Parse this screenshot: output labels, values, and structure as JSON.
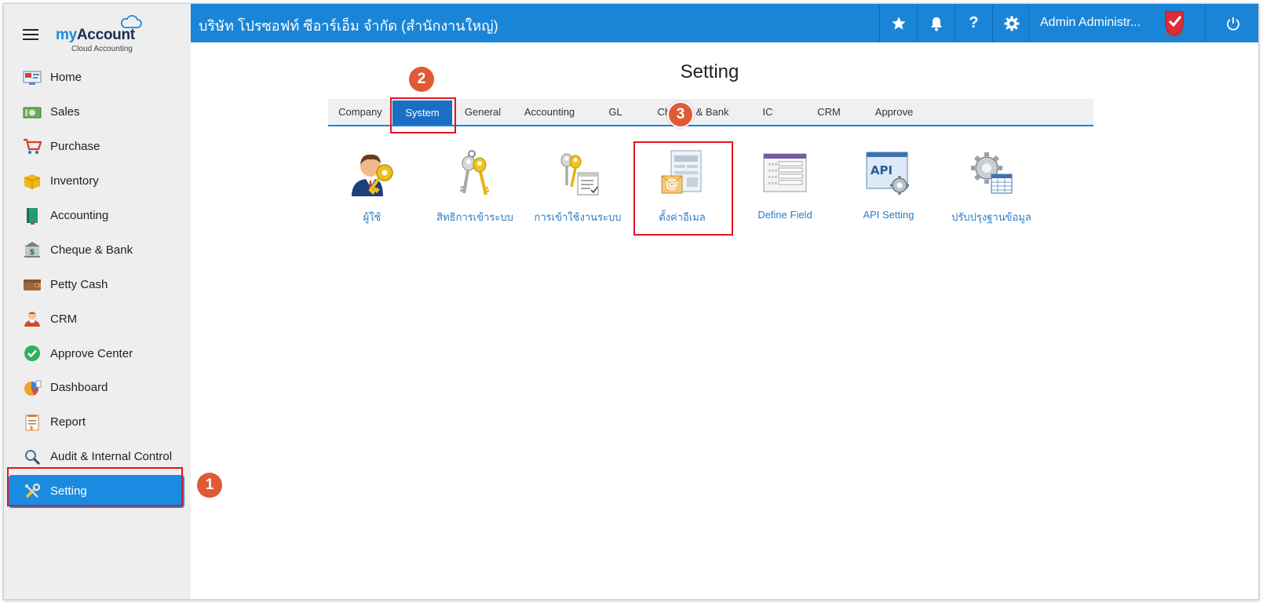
{
  "sidebar": {
    "logo": {
      "brand_my": "my",
      "brand_account": "Account",
      "subtitle": "Cloud Accounting"
    },
    "menu_icon": "hamburger-icon",
    "items": [
      {
        "label": "Home",
        "icon": "home-icon"
      },
      {
        "label": "Sales",
        "icon": "sales-icon"
      },
      {
        "label": "Purchase",
        "icon": "cart-icon"
      },
      {
        "label": "Inventory",
        "icon": "box-icon"
      },
      {
        "label": "Accounting",
        "icon": "ledger-icon"
      },
      {
        "label": "Cheque & Bank",
        "icon": "bank-icon"
      },
      {
        "label": "Petty Cash",
        "icon": "wallet-icon"
      },
      {
        "label": "CRM",
        "icon": "crm-icon"
      },
      {
        "label": "Approve Center",
        "icon": "check-circle-icon"
      },
      {
        "label": "Dashboard",
        "icon": "dashboard-icon"
      },
      {
        "label": "Report",
        "icon": "report-icon"
      },
      {
        "label": "Audit & Internal Control",
        "icon": "magnifier-icon"
      },
      {
        "label": "Setting",
        "icon": "tools-icon",
        "active": true
      }
    ]
  },
  "header": {
    "company": "บริษัท โปรซอฟท์ ซีอาร์เอ็ม จำกัด (สำนักงานใหญ่)",
    "help_glyph": "?",
    "username": "Admin Administr...",
    "icons": [
      "star-icon",
      "bell-icon",
      "help-icon",
      "gear-icon",
      "avatar",
      "power-icon"
    ]
  },
  "main": {
    "title": "Setting",
    "tabs": [
      {
        "label": "Company"
      },
      {
        "label": "System",
        "active": true
      },
      {
        "label": "General"
      },
      {
        "label": "Accounting"
      },
      {
        "label": "GL"
      },
      {
        "label": "Cheque & Bank"
      },
      {
        "label": "IC"
      },
      {
        "label": "CRM"
      },
      {
        "label": "Approve"
      }
    ],
    "tiles": [
      {
        "label": "ผู้ใช้",
        "icon": "user-key-icon"
      },
      {
        "label": "สิทธิการเข้าระบบ",
        "icon": "keys-icon"
      },
      {
        "label": "การเข้าใช้งานระบบ",
        "icon": "key-list-icon"
      },
      {
        "label": "ตั้งค่าอีเมล",
        "icon": "email-setting-icon"
      },
      {
        "label": "Define Field",
        "icon": "form-field-icon"
      },
      {
        "label": "API Setting",
        "icon": "api-icon"
      },
      {
        "label": "ปรับปรุงฐานข้อมูล",
        "icon": "database-gear-icon"
      }
    ]
  },
  "annotations": {
    "step1": "1",
    "step2": "2",
    "step3": "3"
  },
  "colors": {
    "topbar": "#1a85d6",
    "accent": "#1a8be0",
    "highlight": "#e0161f",
    "step_badge": "#df5a35",
    "sidebar_bg": "#eeeeee"
  }
}
